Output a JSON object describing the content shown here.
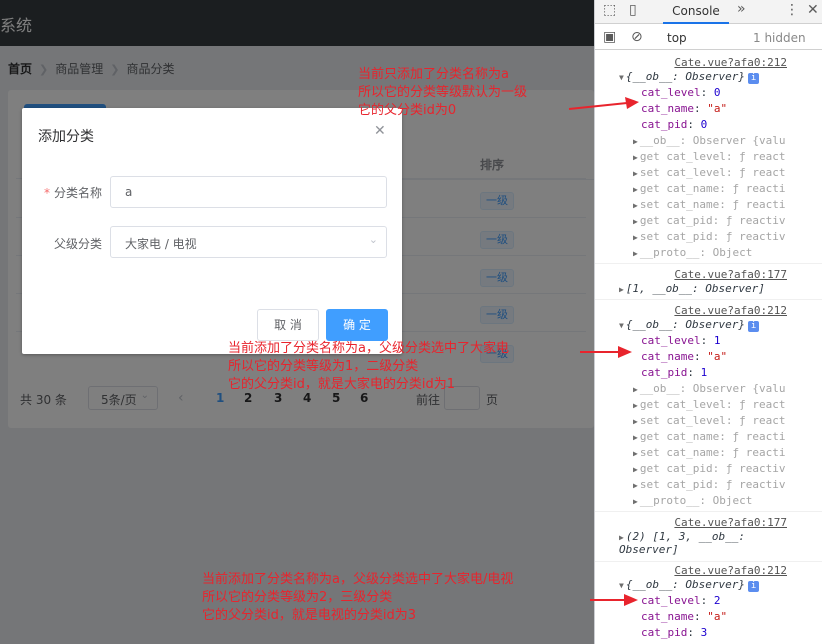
{
  "app": {
    "title": "系统",
    "breadcrumb": [
      "首页",
      "商品管理",
      "商品分类"
    ],
    "table": {
      "sort_header": "排序",
      "level_tags": [
        "一级",
        "一级",
        "一级",
        "一级",
        "一级"
      ]
    },
    "pagination": {
      "total": "共 30 条",
      "page_size": "5条/页",
      "pages": [
        "1",
        "2",
        "3",
        "4",
        "5",
        "6"
      ],
      "goto_label": "前往",
      "goto_suffix": "页"
    }
  },
  "dialog": {
    "title": "添加分类",
    "name_label": "分类名称",
    "name_value": "a",
    "parent_label": "父级分类",
    "parent_value": "大家电 / 电视",
    "cancel_label": "取 消",
    "confirm_label": "确 定"
  },
  "devtools": {
    "tab": "Console",
    "context": "top",
    "hidden_count": "1 hidden",
    "groups": [
      {
        "source": "Cate.vue?afa0:212",
        "header": "{__ob__: Observer}",
        "cat_level": "0",
        "cat_name": "\"a\"",
        "cat_pid": "0"
      },
      {
        "source": "Cate.vue?afa0:177",
        "header": "[1, __ob__: Observer]"
      },
      {
        "source": "Cate.vue?afa0:212",
        "header": "{__ob__: Observer}",
        "cat_level": "1",
        "cat_name": "\"a\"",
        "cat_pid": "1"
      },
      {
        "source": "Cate.vue?afa0:177",
        "header": "(2) [1, 3, __ob__: Observer]"
      },
      {
        "source": "Cate.vue?afa0:212",
        "header": "{__ob__: Observer}",
        "cat_level": "2",
        "cat_name": "\"a\"",
        "cat_pid": "3"
      }
    ],
    "extra": {
      "ob_line": "__ob__: Observer {valu",
      "get_level": "get cat_level: ƒ react",
      "set_level": "set cat_level: ƒ react",
      "get_name": "get cat_name: ƒ reacti",
      "set_name": "set cat_name: ƒ reacti",
      "get_pid": "get cat_pid: ƒ reactiv",
      "set_pid": "set cat_pid: ƒ reactiv",
      "proto": "__proto__: Object"
    }
  },
  "annotations": {
    "a1": [
      "当前只添加了分类名称为a",
      "所以它的分类等级默认为一级",
      "它的父分类id为0"
    ],
    "a2": [
      "当前添加了分类名称为a，父级分类选中了大家电",
      "所以它的分类等级为1，二级分类",
      "它的父分类id，就是大家电的分类id为1"
    ],
    "a3": [
      "当前添加了分类名称为a，父级分类选中了大家电/电视",
      "所以它的分类等级为2，三级分类",
      "它的父分类id，就是电视的分类id为3"
    ]
  },
  "colors": {
    "header": "#373d41",
    "primary": "#409eff",
    "annotation": "#e8242d"
  }
}
